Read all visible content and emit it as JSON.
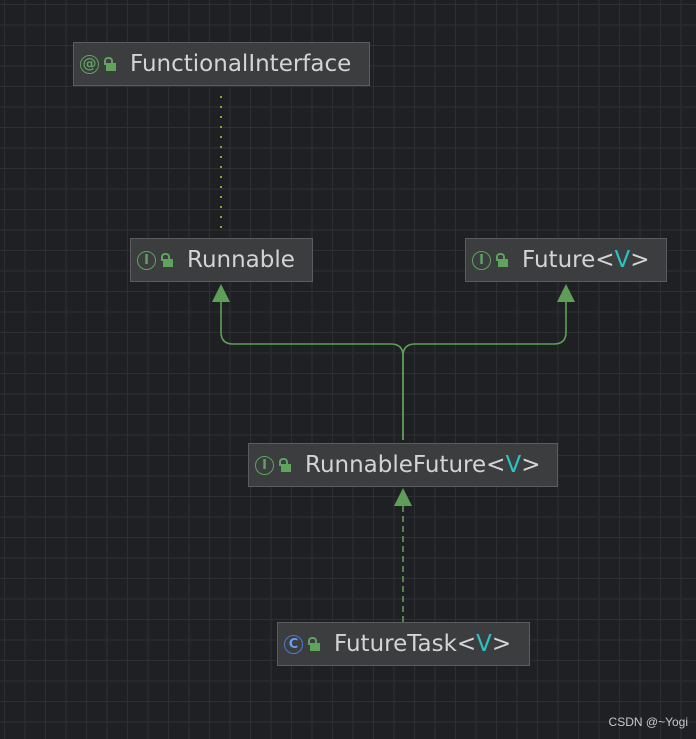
{
  "diagram": {
    "nodes": [
      {
        "id": "functional-interface",
        "kind": "annotation",
        "kind_symbol": "@",
        "name": "FunctionalInterface",
        "type_param": ""
      },
      {
        "id": "runnable",
        "kind": "interface",
        "kind_symbol": "I",
        "name": "Runnable",
        "type_param": ""
      },
      {
        "id": "future",
        "kind": "interface",
        "kind_symbol": "I",
        "name": "Future",
        "type_param": "V"
      },
      {
        "id": "runnable-future",
        "kind": "interface",
        "kind_symbol": "I",
        "name": "RunnableFuture",
        "type_param": "V"
      },
      {
        "id": "future-task",
        "kind": "class",
        "kind_symbol": "C",
        "name": "FutureTask",
        "type_param": "V"
      }
    ],
    "edges": [
      {
        "from": "runnable",
        "to": "functional-interface",
        "style": "dotted",
        "relation": "annotated-by"
      },
      {
        "from": "runnable-future",
        "to": "runnable",
        "style": "solid",
        "relation": "extends"
      },
      {
        "from": "runnable-future",
        "to": "future",
        "style": "solid",
        "relation": "extends"
      },
      {
        "from": "future-task",
        "to": "runnable-future",
        "style": "dashed",
        "relation": "implements"
      }
    ],
    "colors": {
      "background": "#1f2023",
      "node_fill": "#3b3d3f",
      "interface_icon": "#5fa35f",
      "class_icon": "#4b7bd6",
      "type_param": "#2ec1c1",
      "edge_line": "#5f9e58",
      "dotted_edge": "#9a9a2e"
    },
    "icons": {
      "access": "lock-icon"
    }
  },
  "watermark": "CSDN @~Yogi"
}
